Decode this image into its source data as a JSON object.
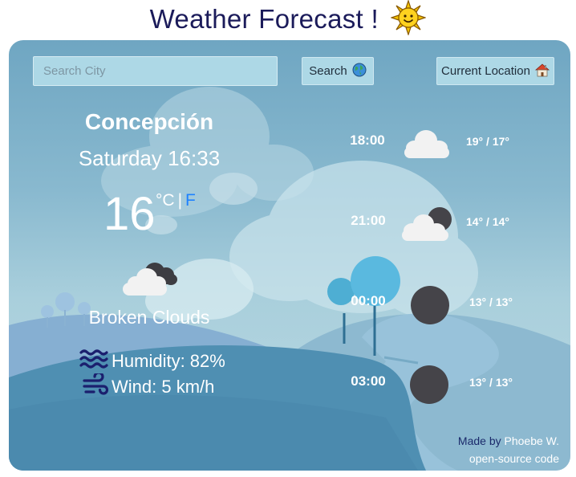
{
  "page": {
    "title": "Weather Forecast !",
    "title_icon": "sun-emoji-icon"
  },
  "search": {
    "placeholder": "Search City",
    "button_label": "Search",
    "button_icon": "globe-icon",
    "location_label": "Current Location",
    "location_icon": "house-icon"
  },
  "current": {
    "city": "Concepción",
    "datetime": "Saturday 16:33",
    "temperature": "16",
    "unit_c": "°C",
    "unit_separator": "|",
    "unit_f": "F",
    "condition_icon": "broken-clouds-icon",
    "description": "Broken Clouds",
    "humidity_label": "Humidity: 82%",
    "humidity_icon": "waves-icon",
    "wind_label": "Wind: 5 km/h",
    "wind_icon": "wind-icon"
  },
  "forecast": [
    {
      "time": "18:00",
      "temps": "19° / 17°",
      "icon": "cloud-icon"
    },
    {
      "time": "21:00",
      "temps": "14° / 14°",
      "icon": "moon-cloud-icon"
    },
    {
      "time": "00:00",
      "temps": "13° / 13°",
      "icon": "moon-icon"
    },
    {
      "time": "03:00",
      "temps": "13° / 13°",
      "icon": "moon-icon"
    }
  ],
  "footer": {
    "made_by": "Made by",
    "author": "Phoebe W.",
    "source_link": "open-source code"
  },
  "colors": {
    "title": "#1b1b5a",
    "input_bg": "#add8e6",
    "unit_f_link": "#1e82ff",
    "moon": "#454449"
  }
}
